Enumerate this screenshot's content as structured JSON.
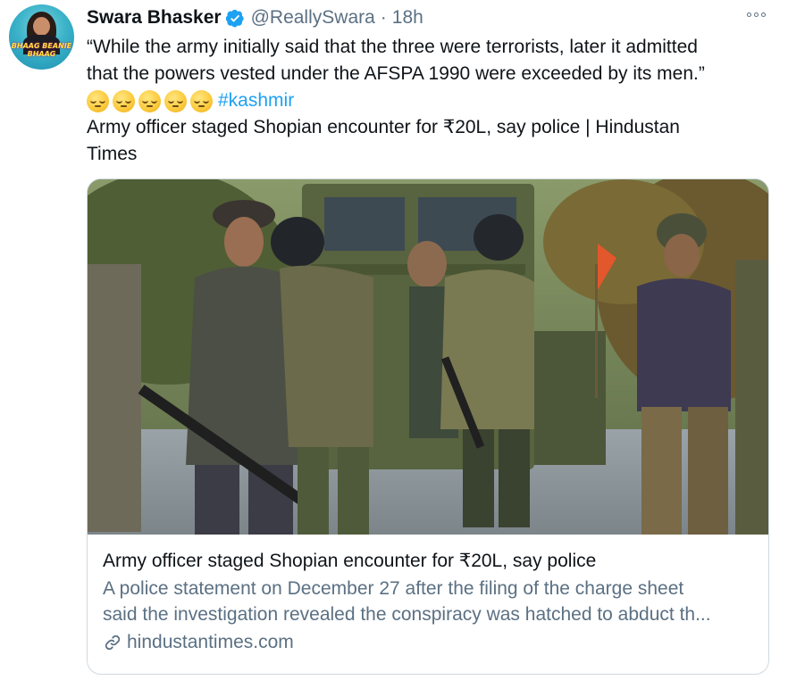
{
  "tweet": {
    "author_name": "Swara Bhasker",
    "handle": "@ReallySwara",
    "separator": "·",
    "time": "18h",
    "avatar_text": "BHAAG BEANIE BHAAG",
    "text_lines": [
      "“While the army initially said that the three were terrorists, later it admitted",
      "that the powers vested under the AFSPA 1990 were exceeded by its men.”"
    ],
    "emoji_icon": "pensive-face",
    "emoji_count": 5,
    "hashtag": "#kashmir",
    "headline_lines": [
      "Army officer staged Shopian encounter for ₹20L, say police | Hindustan",
      "Times"
    ],
    "verified_icon": "verified-badge",
    "more_icon": "more-options"
  },
  "card": {
    "image_alt": "Army personnel standing on a road beside an armoured vehicle",
    "title": "Army officer staged Shopian encounter for ₹20L, say police",
    "description_lines": [
      "A police statement on December 27 after the filing of the charge sheet",
      "said the investigation revealed the conspiracy was hatched to abduct th..."
    ],
    "domain": "hindustantimes.com",
    "link_icon": "link"
  },
  "colors": {
    "text": "#0f1419",
    "secondary": "#5b7083",
    "accent": "#1da1f2",
    "border": "#cfd9de"
  }
}
